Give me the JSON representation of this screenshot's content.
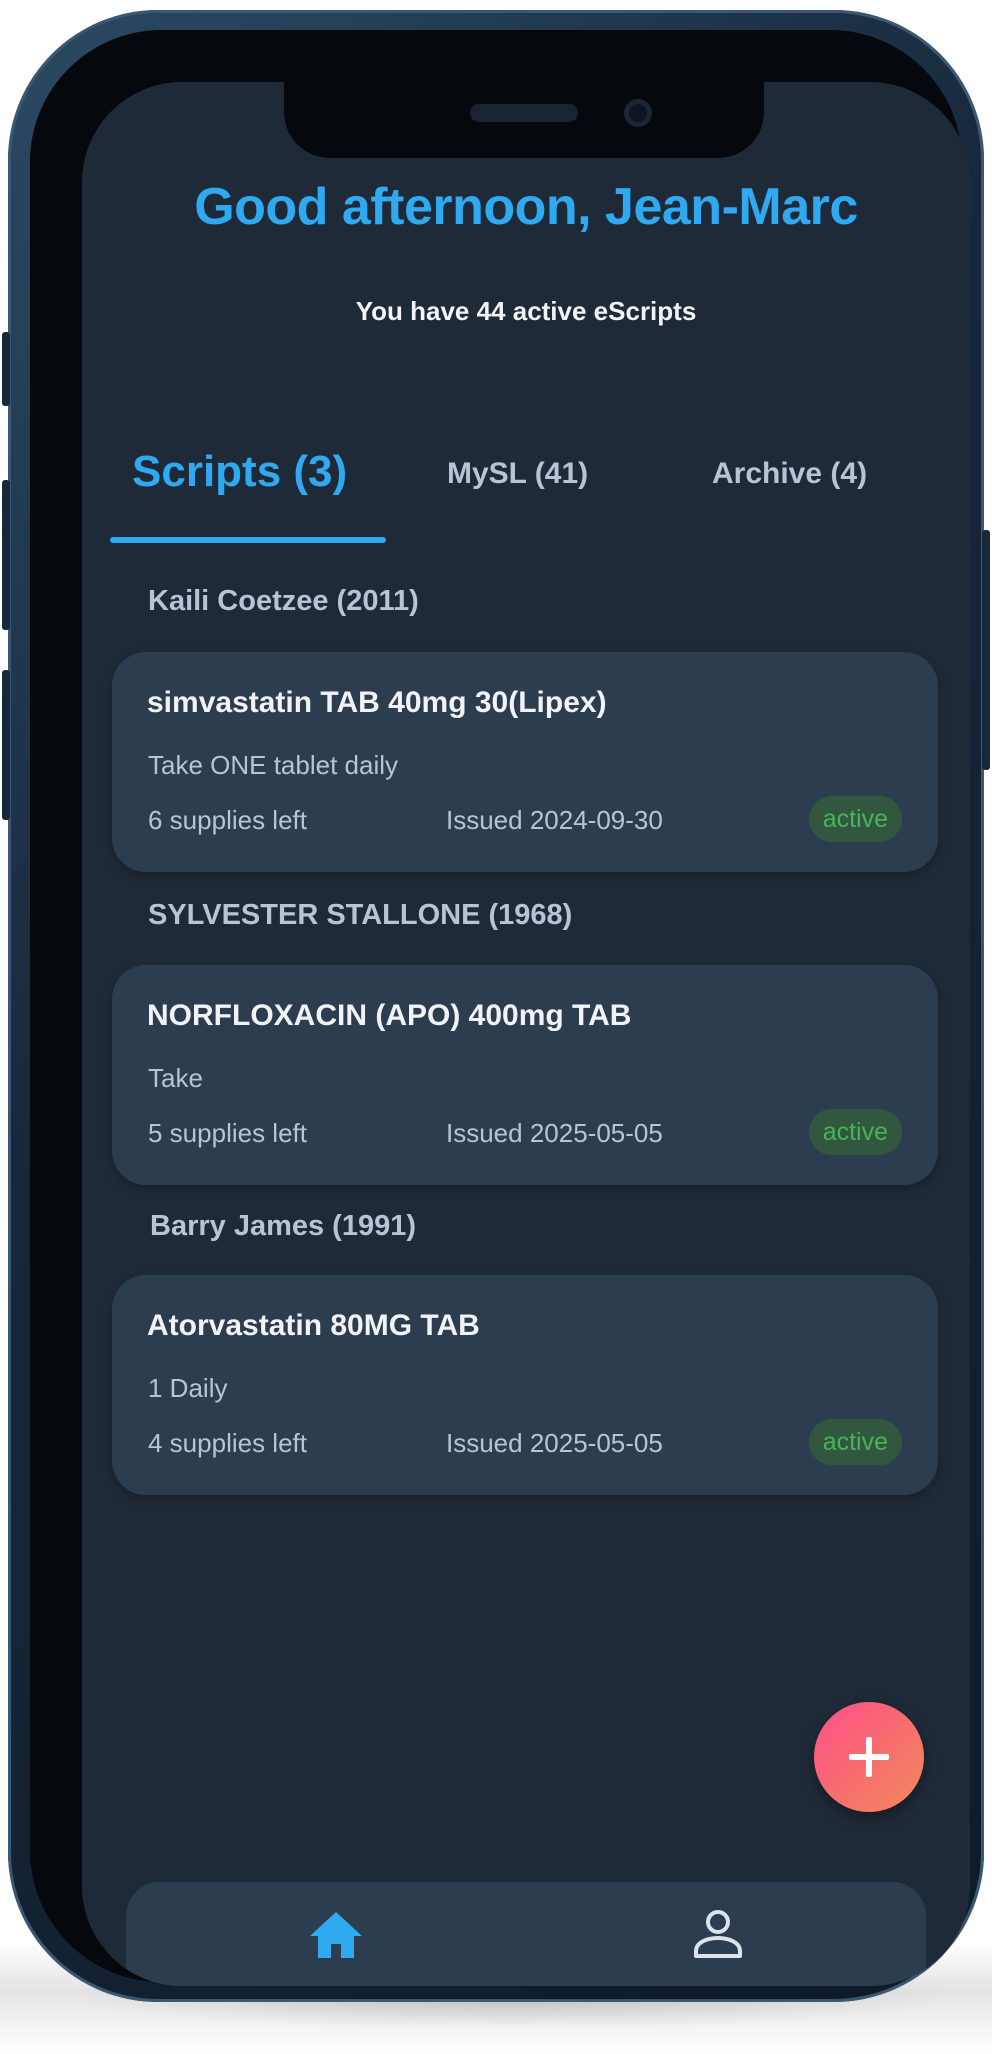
{
  "header": {
    "greeting": "Good afternoon, Jean-Marc",
    "subtitle": "You have 44 active eScripts"
  },
  "tabs": [
    {
      "label": "Scripts (3)",
      "active": true
    },
    {
      "label": "MySL (41)",
      "active": false
    },
    {
      "label": "Archive (4)",
      "active": false
    }
  ],
  "groups": [
    {
      "patient": "Kaili Coetzee (2011)",
      "script": {
        "drug": "simvastatin TAB 40mg 30(Lipex)",
        "instructions": "Take ONE tablet daily",
        "supplies": "6 supplies left",
        "issued": "Issued 2024-09-30",
        "status": "active"
      }
    },
    {
      "patient": "SYLVESTER STALLONE (1968)",
      "script": {
        "drug": "NORFLOXACIN (APO) 400mg TAB",
        "instructions": "Take",
        "supplies": "5 supplies left",
        "issued": "Issued 2025-05-05",
        "status": "active"
      }
    },
    {
      "patient": "Barry James (1991)",
      "script": {
        "drug": "Atorvastatin 80MG TAB",
        "instructions": "1 Daily",
        "supplies": "4 supplies left",
        "issued": "Issued 2025-05-05",
        "status": "active"
      }
    }
  ],
  "icons": {
    "fab": "plus-icon",
    "nav_home": "home-icon",
    "nav_profile": "person-icon"
  },
  "colors": {
    "accent": "#2fa9f0",
    "background": "#1f2a38",
    "card": "#2c3d4f",
    "status_active_text": "#47b35a",
    "status_active_bg": "#31583f",
    "fab_gradient_start": "#ff4f8b",
    "fab_gradient_end": "#f28a5f"
  }
}
